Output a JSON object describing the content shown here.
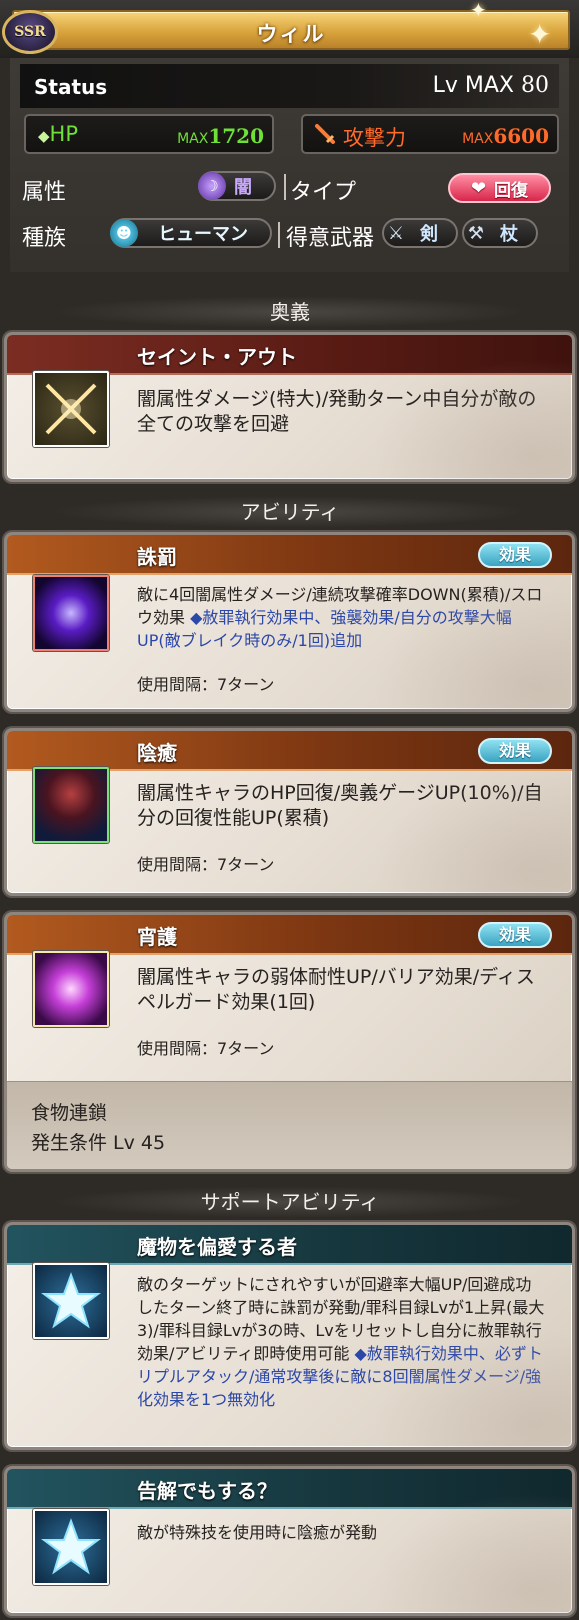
{
  "header": {
    "title": "ウィル",
    "rarity": "SSR"
  },
  "status": {
    "label": "Status",
    "level_label": "Lv MAX",
    "level_value": "80",
    "hp": {
      "label": "HP",
      "max_label": "MAX",
      "value": "1720"
    },
    "attack": {
      "label": "攻撃力",
      "max_label": "MAX",
      "value": "6600"
    },
    "element_label": "属性",
    "element_value": "闇",
    "type_label": "タイプ",
    "type_value": "回復",
    "race_label": "種族",
    "race_value": "ヒューマン",
    "weapon_label": "得意武器",
    "weapons": [
      "剣",
      "杖"
    ]
  },
  "sections": {
    "ougi": "奥義",
    "abilities": "アビリティ",
    "support": "サポートアビリティ"
  },
  "ougi": {
    "name": "セイント・アウト",
    "description": "闇属性ダメージ(特大)/発動ターン中自分が敵の全ての攻撃を回避"
  },
  "abilities": [
    {
      "name": "誅罰",
      "effect_label": "効果",
      "description": "敵に4回闇属性ダメージ/連続攻撃確率DOWN(累積)/スロウ効果",
      "extra": "◆赦罪執行効果中、強襲効果/自分の攻撃大幅UP(敵ブレイク時のみ/1回)追加",
      "cooldown": "使用間隔：7ターン"
    },
    {
      "name": "陰癒",
      "effect_label": "効果",
      "description": "闇属性キャラのHP回復/奥義ゲージUP(10%)/自分の回復性能UP(累積)",
      "cooldown": "使用間隔：7ターン"
    },
    {
      "name": "宵護",
      "effect_label": "効果",
      "description": "闇属性キャラの弱体耐性UP/バリア効果/ディスペルガード効果(1回)",
      "cooldown": "使用間隔：7ターン",
      "food_chain_label": "食物連鎖",
      "food_chain_condition": "発生条件 Lv 45"
    }
  ],
  "support_abilities": [
    {
      "name": "魔物を偏愛する者",
      "description": "敵のターゲットにされやすいが回避率大幅UP/回避成功したターン終了時に誅罰が発動/罪科目録Lvが1上昇(最大3)/罪科目録Lvが3の時、Lvをリセットし自分に赦罪執行効果/アビリティ即時使用可能",
      "extra": "◆赦罪執行効果中、必ずトリプルアタック/通常攻撃後に敵に8回闇属性ダメージ/強化効果を1つ無効化"
    },
    {
      "name": "告解でもする？",
      "description": "敵が特殊技を使用時に陰癒が発動"
    }
  ],
  "colors": {
    "hp": "#6fe038",
    "attack": "#ff6a2a",
    "effect_button": "#3aa3c1",
    "link_blue": "#2b47a8"
  }
}
